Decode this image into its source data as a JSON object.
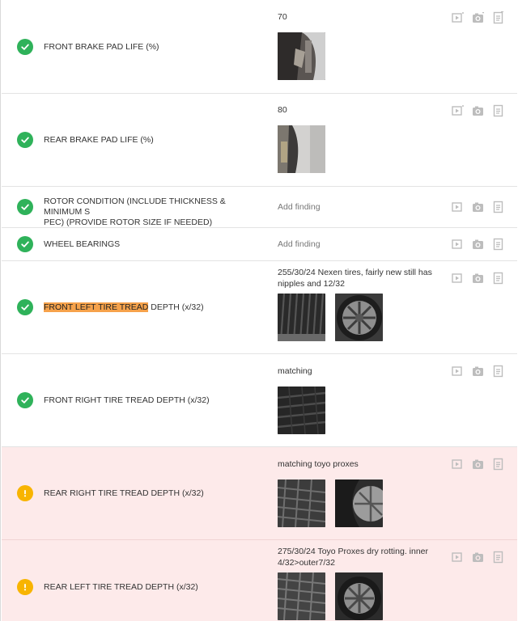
{
  "colors": {
    "ok": "#2fb25a",
    "warn": "#f8b400",
    "warn_row_bg": "#fdeaea",
    "highlight": "#f6a24b"
  },
  "icons": [
    "video-icon",
    "camera-icon",
    "notes-icon"
  ],
  "rows": [
    {
      "status": "ok",
      "label": "FRONT BRAKE PAD LIFE (%)",
      "finding": "70",
      "thumbnails": 1
    },
    {
      "status": "ok",
      "label": "REAR BRAKE PAD LIFE (%)",
      "finding": "80",
      "thumbnails": 1
    },
    {
      "status": "ok",
      "label": "ROTOR CONDITION (INCLUDE THICKNESS & MINIMUM S PEC) (PROVIDE ROTOR SIZE IF NEEDED)",
      "label_line1": "ROTOR CONDITION (INCLUDE THICKNESS & MINIMUM S",
      "label_line2": "PEC) (PROVIDE ROTOR SIZE IF NEEDED)",
      "finding_placeholder": "Add finding"
    },
    {
      "status": "ok",
      "label": "WHEEL BEARINGS",
      "finding_placeholder": "Add finding"
    },
    {
      "status": "ok",
      "label_highlight": "FRONT LEFT TIRE TREAD",
      "label_rest": " DEPTH (x/32)",
      "finding": "255/30/24 Nexen tires, fairly new still has nipples and 12/32",
      "thumbnails": 2
    },
    {
      "status": "ok",
      "label": "FRONT RIGHT TIRE TREAD DEPTH (x/32)",
      "finding": "matching",
      "thumbnails": 1
    },
    {
      "status": "warn",
      "label": "REAR RIGHT TIRE TREAD DEPTH (x/32)",
      "finding": "matching toyo proxes",
      "thumbnails": 2
    },
    {
      "status": "warn",
      "label": "REAR LEFT TIRE TREAD DEPTH (x/32)",
      "finding": "275/30/24 Toyo Proxes dry rotting. inner 4/32>outer7/32",
      "thumbnails": 2
    }
  ]
}
